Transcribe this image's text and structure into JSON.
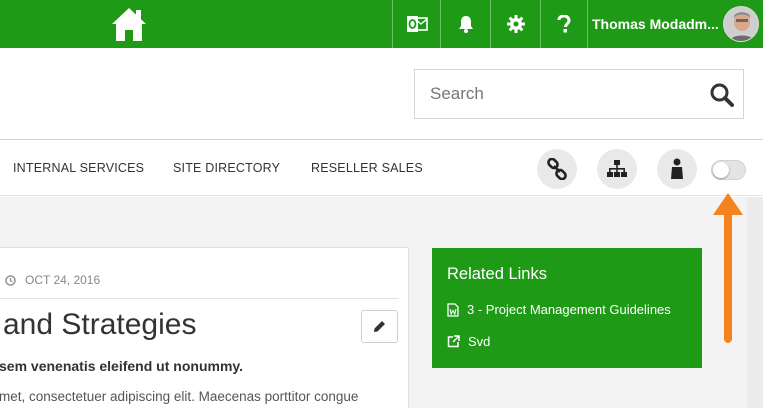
{
  "topbar": {
    "user_name": "Thomas Modadm..."
  },
  "search": {
    "placeholder": "Search"
  },
  "nav": {
    "items": [
      "INTERNAL SERVICES",
      "SITE DIRECTORY",
      "RESELLER SALES"
    ]
  },
  "article": {
    "date": "OCT 24, 2016",
    "title": "and Strategies",
    "subtitle": "sem venenatis eleifend ut nonummy.",
    "body": "met, consectetuer adipiscing elit. Maecenas porttitor congue"
  },
  "related_links": {
    "heading": "Related Links",
    "items": [
      {
        "label": "3 - Project Management Guidelines",
        "icon": "word-document-icon"
      },
      {
        "label": "Svd",
        "icon": "external-link-icon"
      }
    ]
  },
  "colors": {
    "brand_green": "#1f9a16",
    "annotation_arrow": "#f5821f"
  }
}
